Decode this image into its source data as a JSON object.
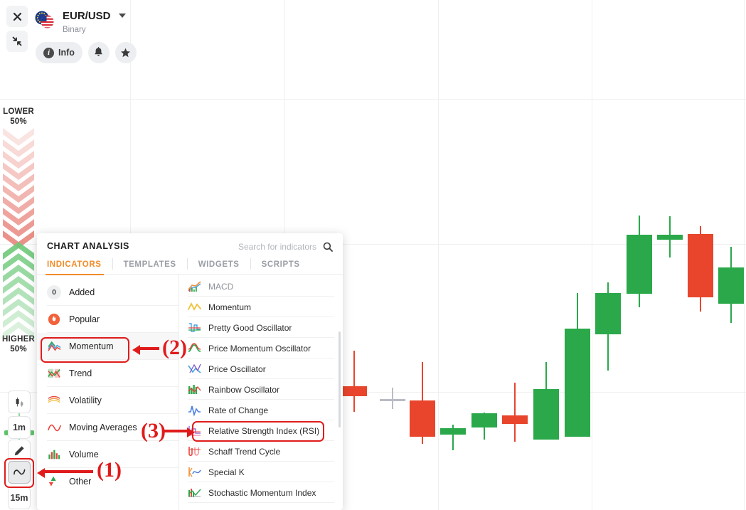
{
  "window": {
    "close_label": "✕",
    "collapse_label": "⤡"
  },
  "asset": {
    "name": "EUR/USD",
    "subtitle": "Binary",
    "flag_icon": "eu-us-flag-icon",
    "caret_icon": "chevron-down-icon",
    "actions": [
      {
        "label": "Info",
        "icon": "info-icon"
      },
      {
        "label": "",
        "icon": "bell-icon"
      },
      {
        "label": "",
        "icon": "star-icon"
      }
    ]
  },
  "gauge": {
    "lower_label": "LOWER",
    "lower_percent": "50%",
    "higher_label": "HIGHER",
    "higher_percent": "50%",
    "lower_color": "#e8857c",
    "higher_color": "#6ec97a"
  },
  "rail": {
    "items": [
      {
        "name": "candles-chart-type-button",
        "label": "",
        "icon": "candlestick-icon"
      },
      {
        "name": "timeframe-1m-button",
        "label": "1m",
        "icon": ""
      },
      {
        "name": "draw-tool-button",
        "label": "",
        "icon": "pencil-icon"
      },
      {
        "name": "indicators-button",
        "label": "",
        "icon": "wave-icon"
      },
      {
        "name": "timeframe-15m-button",
        "label": "15m",
        "icon": ""
      }
    ]
  },
  "panel": {
    "title": "CHART ANALYSIS",
    "search": {
      "placeholder": "Search for indicators",
      "value": "",
      "icon": "search-icon"
    },
    "tabs": [
      {
        "label": "INDICATORS",
        "active": true
      },
      {
        "label": "TEMPLATES",
        "active": false
      },
      {
        "label": "WIDGETS",
        "active": false
      },
      {
        "label": "SCRIPTS",
        "active": false
      }
    ],
    "categories": [
      {
        "label": "Added",
        "badge": "0",
        "icon": "count-badge-icon",
        "selected": false
      },
      {
        "label": "Popular",
        "badge": "",
        "icon": "flame-icon",
        "selected": false
      },
      {
        "label": "Momentum",
        "badge": "",
        "icon": "momentum-icon",
        "selected": true
      },
      {
        "label": "Trend",
        "badge": "",
        "icon": "trend-icon",
        "selected": false
      },
      {
        "label": "Volatility",
        "badge": "",
        "icon": "volatility-icon",
        "selected": false
      },
      {
        "label": "Moving Averages",
        "badge": "",
        "icon": "moving-average-icon",
        "selected": false
      },
      {
        "label": "Volume",
        "badge": "",
        "icon": "volume-bars-icon",
        "selected": false
      },
      {
        "label": "Other",
        "badge": "",
        "icon": "other-icon",
        "selected": false
      }
    ],
    "indicators": [
      {
        "label": "MACD",
        "icon": "macd-icon",
        "dim": true,
        "highlighted": false
      },
      {
        "label": "Momentum",
        "icon": "momentum-line-icon",
        "dim": false,
        "highlighted": false
      },
      {
        "label": "Pretty Good Oscillator",
        "icon": "pretty-good-oscillator-icon",
        "dim": false,
        "highlighted": false
      },
      {
        "label": "Price Momentum Oscillator",
        "icon": "price-momentum-oscillator-icon",
        "dim": false,
        "highlighted": false
      },
      {
        "label": "Price Oscillator",
        "icon": "price-oscillator-icon",
        "dim": false,
        "highlighted": false
      },
      {
        "label": "Rainbow Oscillator",
        "icon": "rainbow-oscillator-icon",
        "dim": false,
        "highlighted": false
      },
      {
        "label": "Rate of Change",
        "icon": "rate-of-change-icon",
        "dim": false,
        "highlighted": false
      },
      {
        "label": "Relative Strength Index (RSI)",
        "icon": "rsi-icon",
        "dim": false,
        "highlighted": true
      },
      {
        "label": "Schaff Trend Cycle",
        "icon": "schaff-trend-cycle-icon",
        "dim": false,
        "highlighted": false
      },
      {
        "label": "Special K",
        "icon": "special-k-icon",
        "dim": false,
        "highlighted": false
      },
      {
        "label": "Stochastic Momentum Index",
        "icon": "stochastic-momentum-index-icon",
        "dim": false,
        "highlighted": false
      }
    ]
  },
  "annotations": {
    "accent_color": "#e01b1b",
    "steps": [
      {
        "label": "(1)",
        "target": "indicators-button"
      },
      {
        "label": "(2)",
        "target": "category-momentum"
      },
      {
        "label": "(3)",
        "target": "indicator-rsi"
      }
    ]
  },
  "chart_data": {
    "type": "candlestick",
    "title": "",
    "up_color": "#2aa84a",
    "down_color": "#e8452c",
    "doji_color": "#b9bcc4",
    "candles": [
      {
        "open": 543,
        "close": 557,
        "high": 493,
        "low": 579,
        "dir": "down"
      },
      {
        "open": 561,
        "close": 561,
        "high": 545,
        "low": 575,
        "dir": "doji"
      },
      {
        "open": 563,
        "close": 614,
        "high": 509,
        "low": 624,
        "dir": "down"
      },
      {
        "open": 611,
        "close": 602,
        "high": 597,
        "low": 633,
        "dir": "up"
      },
      {
        "open": 601,
        "close": 581,
        "high": 580,
        "low": 618,
        "dir": "up"
      },
      {
        "open": 596,
        "close": 584,
        "high": 538,
        "low": 621,
        "dir": "down"
      },
      {
        "open": 618,
        "close": 547,
        "high": 509,
        "low": 618,
        "dir": "up"
      },
      {
        "open": 614,
        "close": 462,
        "high": 412,
        "low": 614,
        "dir": "up"
      },
      {
        "open": 470,
        "close": 412,
        "high": 397,
        "low": 521,
        "dir": "up"
      },
      {
        "open": 413,
        "close": 330,
        "high": 303,
        "low": 432,
        "dir": "up"
      },
      {
        "open": 337,
        "close": 330,
        "high": 304,
        "low": 362,
        "dir": "up"
      },
      {
        "open": 329,
        "close": 418,
        "high": 318,
        "low": 438,
        "dir": "down"
      },
      {
        "open": 376,
        "close": 427,
        "high": 347,
        "low": 454,
        "dir": "up"
      }
    ]
  }
}
